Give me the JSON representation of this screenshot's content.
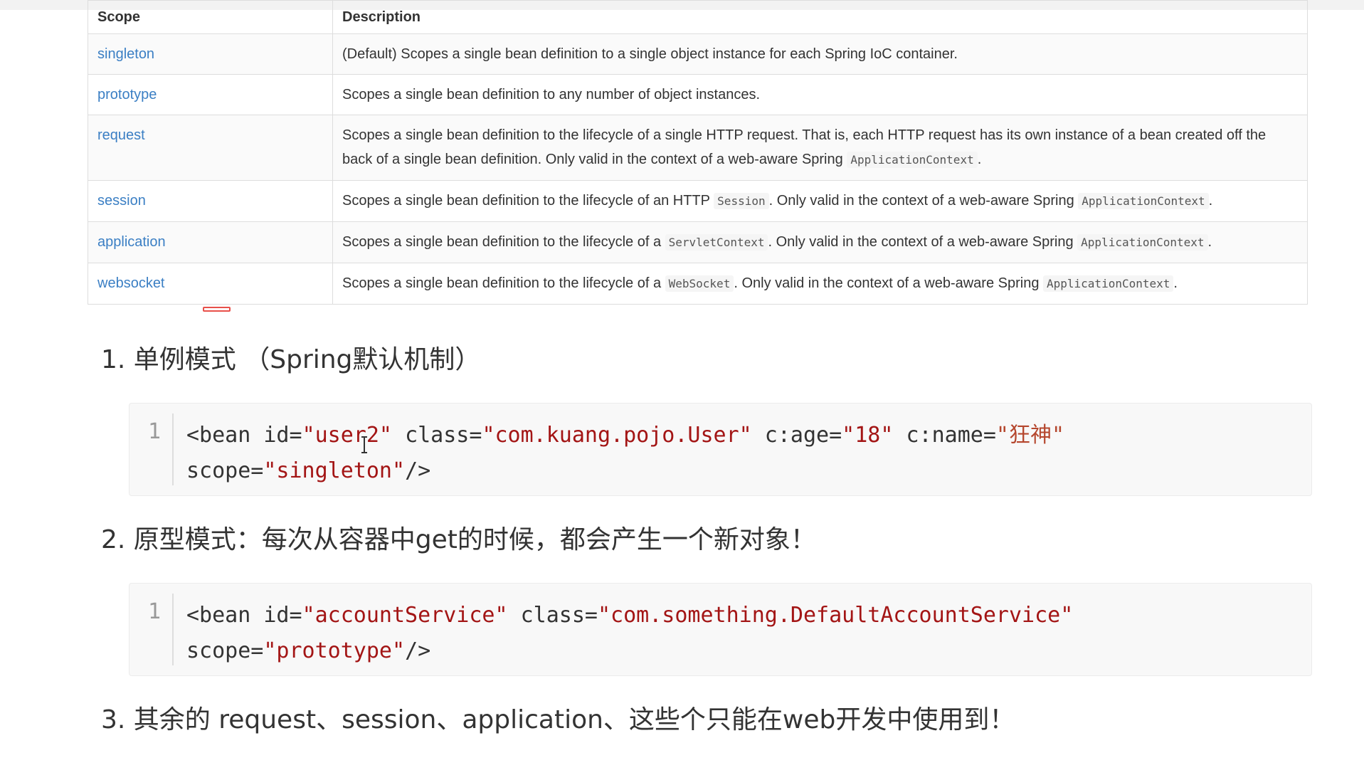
{
  "table": {
    "headers": {
      "scope": "Scope",
      "description": "Description"
    },
    "rows": [
      {
        "scope": "singleton",
        "desc": [
          "(Default) Scopes a single bean definition to a single object instance for each Spring IoC container."
        ]
      },
      {
        "scope": "prototype",
        "desc": [
          "Scopes a single bean definition to any number of object instances."
        ]
      },
      {
        "scope": "request",
        "desc": [
          "Scopes a single bean definition to the lifecycle of a single HTTP request. That is, each HTTP request has its own instance of a bean created off the back of a single bean definition. Only valid in the context of a web-aware Spring ",
          {
            "code": "ApplicationContext"
          },
          "."
        ]
      },
      {
        "scope": "session",
        "desc": [
          "Scopes a single bean definition to the lifecycle of an HTTP ",
          {
            "code": "Session"
          },
          ". Only valid in the context of a web-aware Spring ",
          {
            "code": "ApplicationContext"
          },
          "."
        ]
      },
      {
        "scope": "application",
        "desc": [
          "Scopes a single bean definition to the lifecycle of a ",
          {
            "code": "ServletContext"
          },
          ". Only valid in the context of a web-aware Spring ",
          {
            "code": "ApplicationContext"
          },
          "."
        ]
      },
      {
        "scope": "websocket",
        "desc": [
          "Scopes a single bean definition to the lifecycle of a ",
          {
            "code": "WebSocket"
          },
          ". Only valid in the context of a web-aware Spring ",
          {
            "code": "ApplicationContext"
          },
          "."
        ]
      }
    ]
  },
  "sections": [
    {
      "heading": "1. 单例模式 （Spring默认机制）"
    },
    {
      "heading": "2. 原型模式：每次从容器中get的时候，都会产生一个新对象！"
    },
    {
      "heading": "3. 其余的 request、session、application、这些个只能在web开发中使用到！"
    }
  ],
  "code_blocks": [
    {
      "line_number": "1",
      "line1": {
        "p1": "<bean ",
        "a1": "id=",
        "v1": "\"user2\"",
        "s1": " ",
        "a2": "class=",
        "v2": "\"com.kuang.pojo.User\"",
        "s2": " ",
        "a3": "c:age=",
        "v3": "\"18\"",
        "s3": " ",
        "a4": "c:name=",
        "v4": "\"狂神\""
      },
      "line2": {
        "a1": "scope=",
        "v1": "\"singleton\"",
        "end": "/>"
      }
    },
    {
      "line_number": "1",
      "line1": {
        "p1": "<bean ",
        "a1": "id=",
        "v1": "\"accountService\"",
        "s1": " ",
        "a2": "class=",
        "v2": "\"com.something.DefaultAccountService\""
      },
      "line2": {
        "a1": "scope=",
        "v1": "\"prototype\"",
        "end": "/>"
      }
    }
  ]
}
